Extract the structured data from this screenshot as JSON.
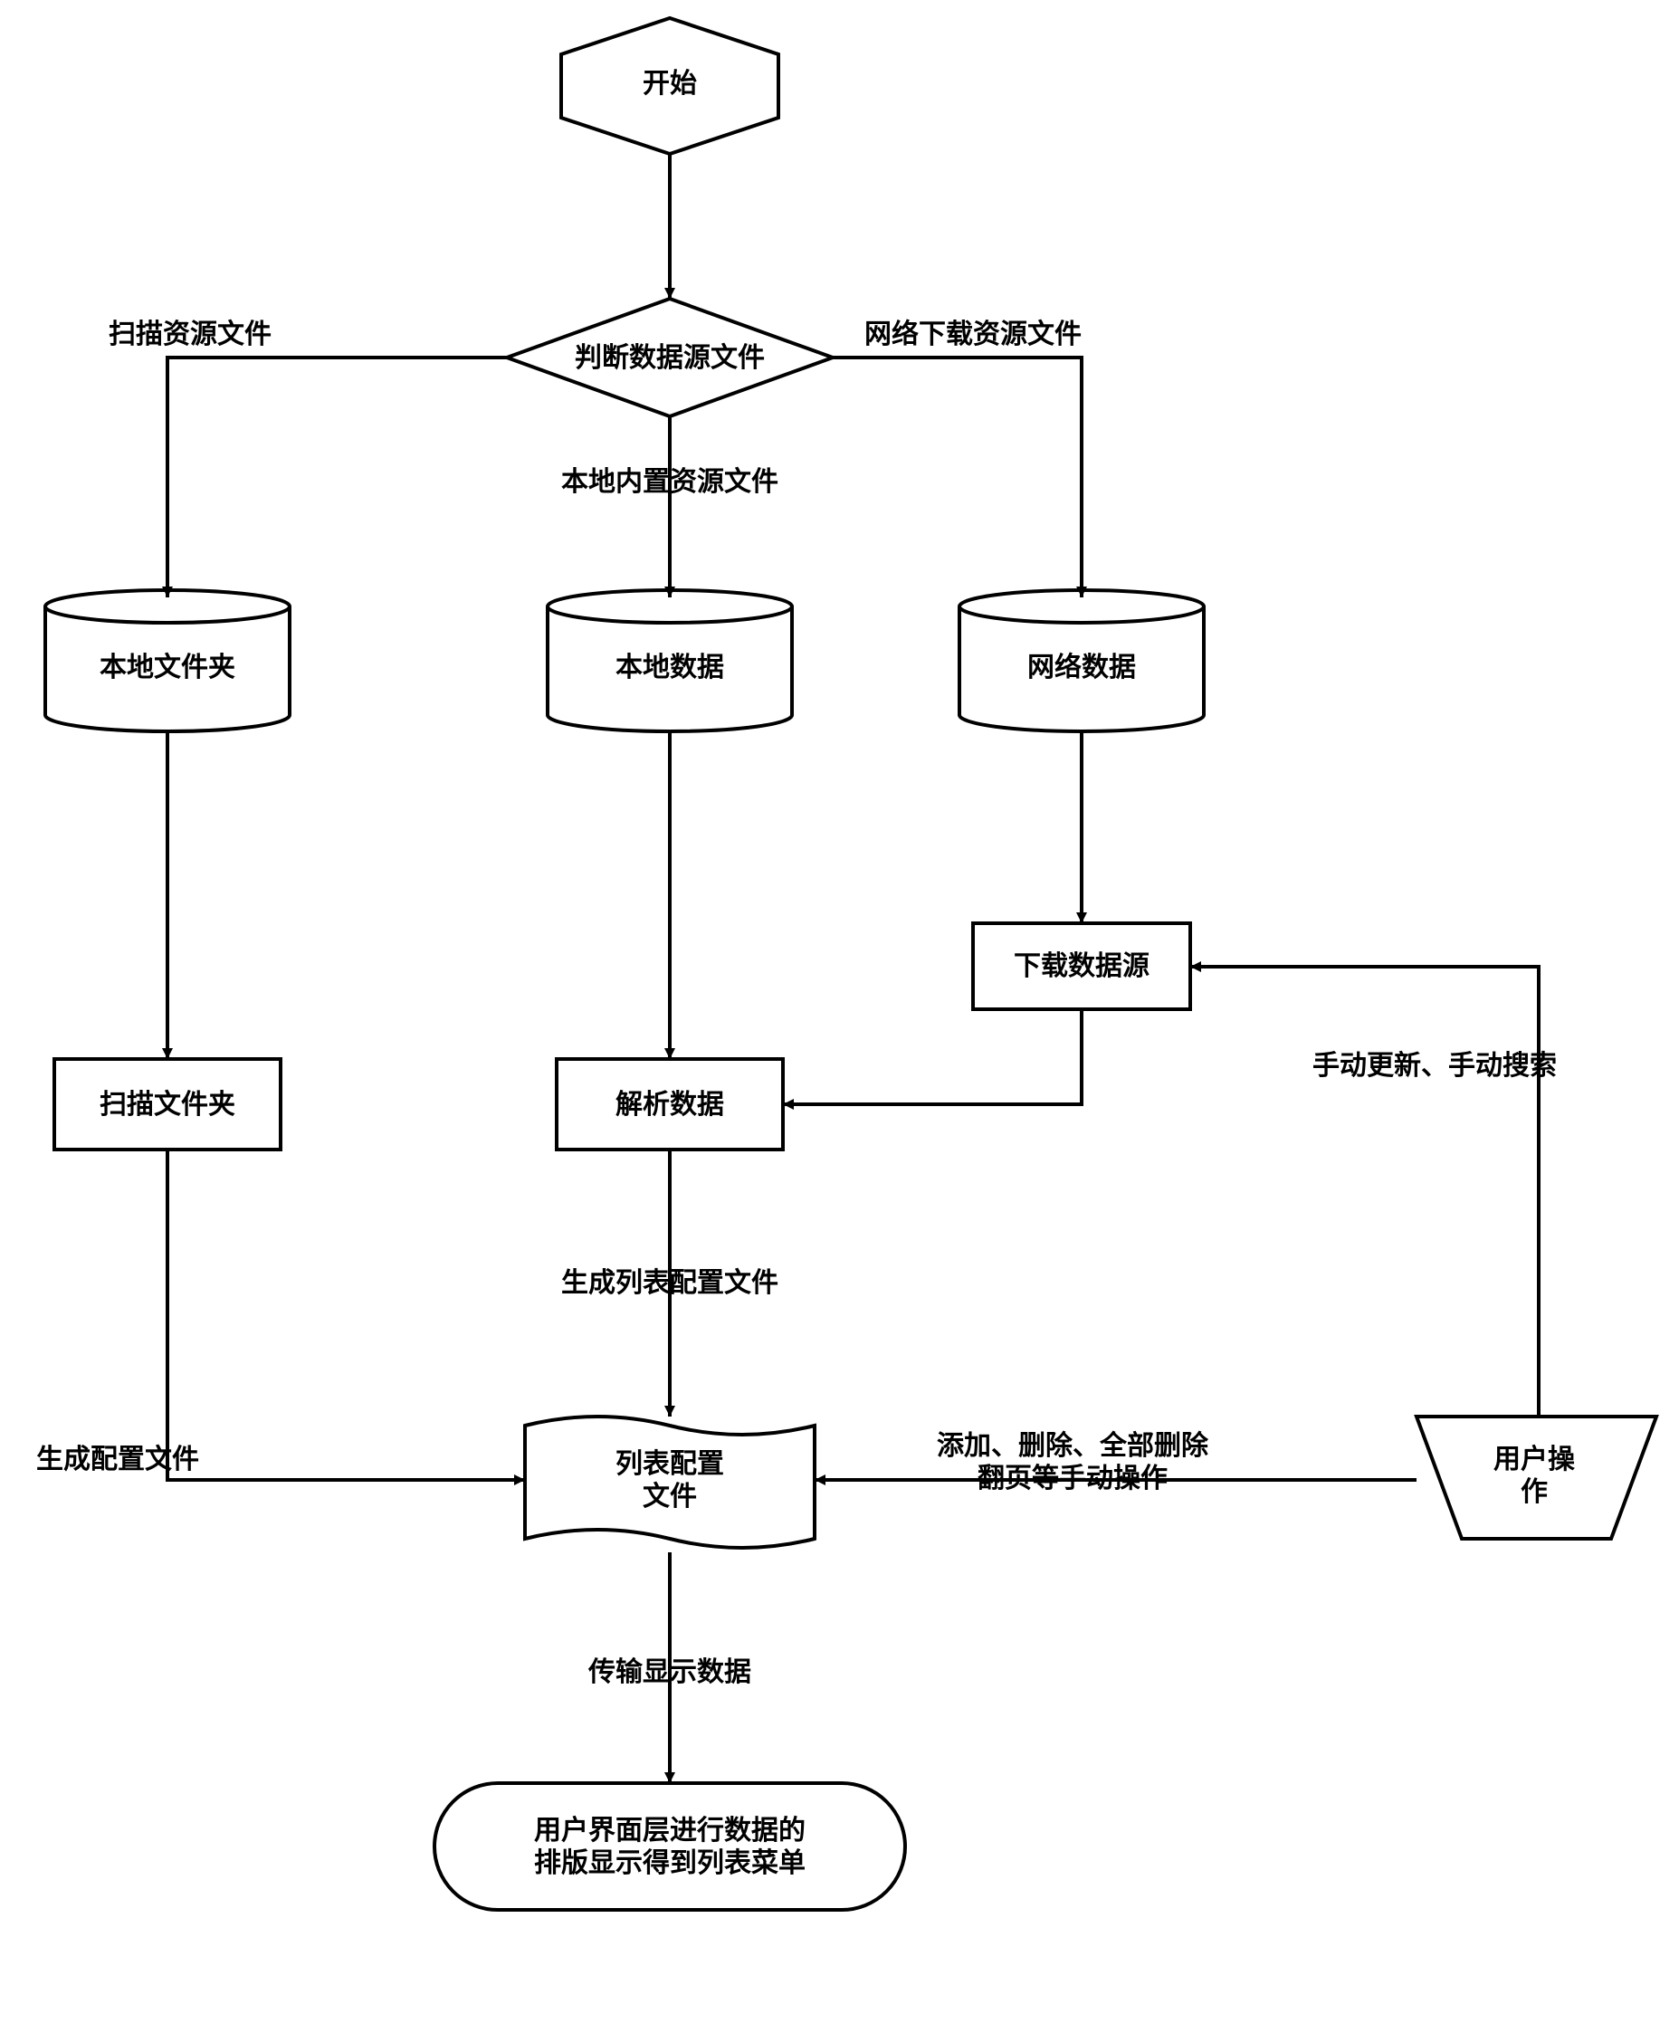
{
  "nodes": {
    "start": "开始",
    "decision": "判断数据源文件",
    "localFolder": "本地文件夹",
    "localData": "本地数据",
    "networkData": "网络数据",
    "downloadSource": "下载数据源",
    "scanFolder": "扫描文件夹",
    "parseData": "解析数据",
    "listConfig": "列表配置\n文件",
    "userOp": "用户操\n作",
    "terminator": "用户界面层进行数据的\n排版显示得到列表菜单"
  },
  "edges": {
    "scanRes": "扫描资源文件",
    "netDownloadRes": "网络下载资源文件",
    "localBuiltIn": "本地内置资源文件",
    "genListConfig": "生成列表配置文件",
    "genConfig": "生成配置文件",
    "addDelete": "添加、删除、全部删除\n翻页等手动操作",
    "manualUpdate": "手动更新、手动搜索",
    "transmitDisplay": "传输显示数据"
  }
}
